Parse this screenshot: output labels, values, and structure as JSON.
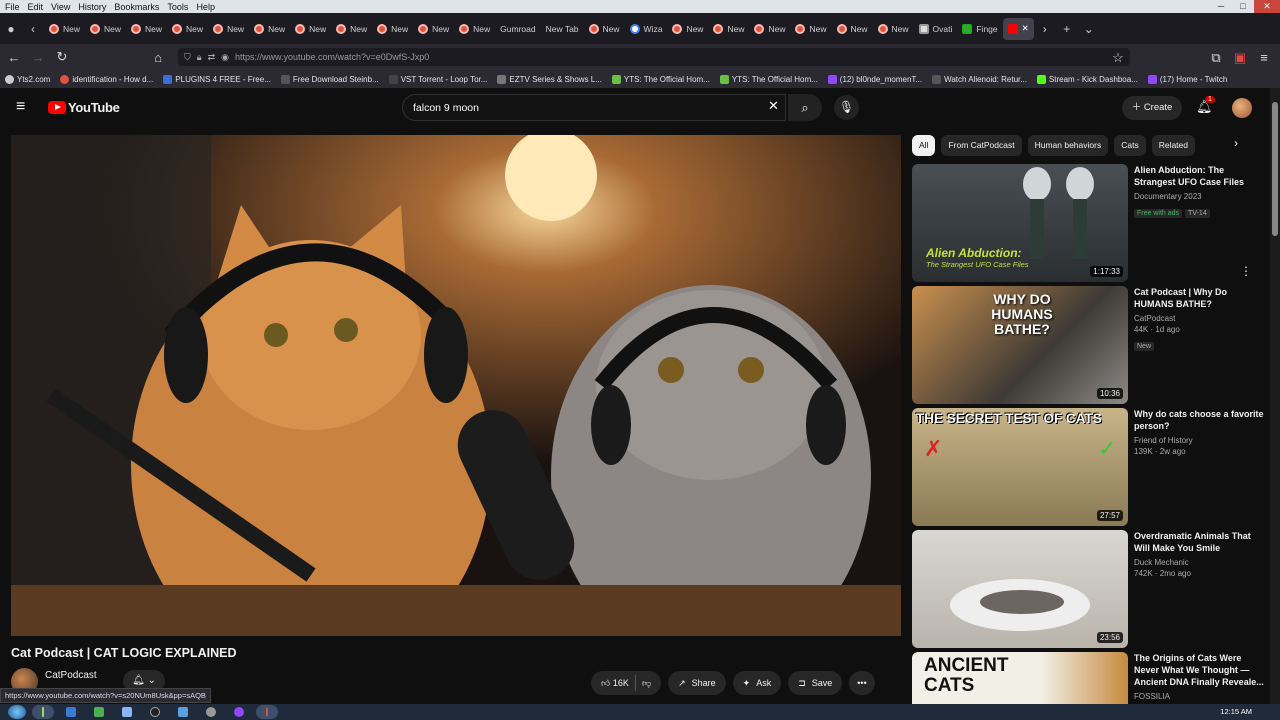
{
  "menubar": {
    "items": [
      "File",
      "Edit",
      "View",
      "History",
      "Bookmarks",
      "Tools",
      "Help"
    ]
  },
  "tabs": [
    {
      "label": "New",
      "icon": "firefox-icon"
    },
    {
      "label": "New",
      "icon": "firefox-icon"
    },
    {
      "label": "New",
      "icon": "firefox-icon"
    },
    {
      "label": "New",
      "icon": "firefox-icon"
    },
    {
      "label": "New",
      "icon": "firefox-icon"
    },
    {
      "label": "New",
      "icon": "firefox-icon"
    },
    {
      "label": "New",
      "icon": "firefox-icon"
    },
    {
      "label": "New",
      "icon": "firefox-icon"
    },
    {
      "label": "New",
      "icon": "firefox-icon"
    },
    {
      "label": "New",
      "icon": "firefox-icon"
    },
    {
      "label": "New",
      "icon": "firefox-icon"
    },
    {
      "label": "Gumroad",
      "icon": "gumroad-icon"
    },
    {
      "label": "New Tab",
      "icon": "firefox-icon"
    },
    {
      "label": "New",
      "icon": "firefox-icon"
    },
    {
      "label": "Wiza",
      "icon": "google-icon"
    },
    {
      "label": "New",
      "icon": "firefox-icon"
    },
    {
      "label": "New",
      "icon": "firefox-icon"
    },
    {
      "label": "New",
      "icon": "firefox-icon"
    },
    {
      "label": "New",
      "icon": "firefox-icon"
    },
    {
      "label": "New",
      "icon": "firefox-icon"
    },
    {
      "label": "New",
      "icon": "firefox-icon"
    },
    {
      "label": "Ovati",
      "icon": "wikipedia-icon"
    },
    {
      "label": "Finge",
      "icon": "green-icon"
    }
  ],
  "url": "https://www.youtube.com/watch?v=e0DwfS-Jxp0",
  "bookmarks": [
    "Yts2.com",
    "identification - How d...",
    "PLUGINS 4 FREE - Free...",
    "Free Download Steinb...",
    "VST Torrent - Loop Tor...",
    "EZTV Series & Shows L...",
    "YTS: The Official Hom...",
    "YTS: The Official Hom...",
    "(12) bl0nde_momenT...",
    "Watch Alienoid: Retur...",
    "Stream - Kick Dashboa...",
    "(17) Home - Twitch"
  ],
  "youtube": {
    "logo_text": "YouTube",
    "search_value": "falcon 9 moon",
    "create_label": "Create",
    "notif_count": "1"
  },
  "video": {
    "title": "Cat Podcast | CAT LOGIC EXPLAINED",
    "channel": "CatPodcast",
    "likes": "16K",
    "share": "Share",
    "ask": "Ask",
    "save": "Save"
  },
  "chips": [
    "All",
    "From CatPodcast",
    "Human behaviors",
    "Cats",
    "Related"
  ],
  "recommendations": [
    {
      "title": "Alien Abduction: The Strangest UFO Case Files",
      "meta1": "Documentary 2023",
      "meta2": "",
      "tags": [
        "Free with ads",
        "TV-14"
      ],
      "duration": "1:17:33",
      "thumb_text": "Alien Abduction:",
      "thumb_sub": "The Strangest UFO Case Files"
    },
    {
      "title": "Cat Podcast | Why Do HUMANS BATHE?",
      "meta1": "CatPodcast",
      "meta2": "44K · 1d ago",
      "tags": [
        "New"
      ],
      "duration": "10:36",
      "thumb_text": "WHY DO HUMANS BATHE?",
      "thumb_sub": ""
    },
    {
      "title": "Why do cats choose a favorite person?",
      "meta1": "Friend of History",
      "meta2": "139K · 2w ago",
      "tags": [],
      "duration": "27:57",
      "thumb_text": "THE SECRET TEST OF CATS",
      "thumb_sub": ""
    },
    {
      "title": "Overdramatic Animals That Will Make You Smile",
      "meta1": "Duck Mechanic",
      "meta2": "742K · 2mo ago",
      "tags": [],
      "duration": "23:56",
      "thumb_text": "",
      "thumb_sub": ""
    },
    {
      "title": "The Origins of Cats Were Never What We Thought — Ancient DNA Finally Reveale...",
      "meta1": "FOSSILIA",
      "meta2": "",
      "tags": [],
      "duration": "",
      "thumb_text": "ANCIENT CATS",
      "thumb_sub": ""
    }
  ],
  "status_url": "https://www.youtube.com/watch?v=s20NUm8Usk&pp=sAQB",
  "clock": "12:15 AM"
}
